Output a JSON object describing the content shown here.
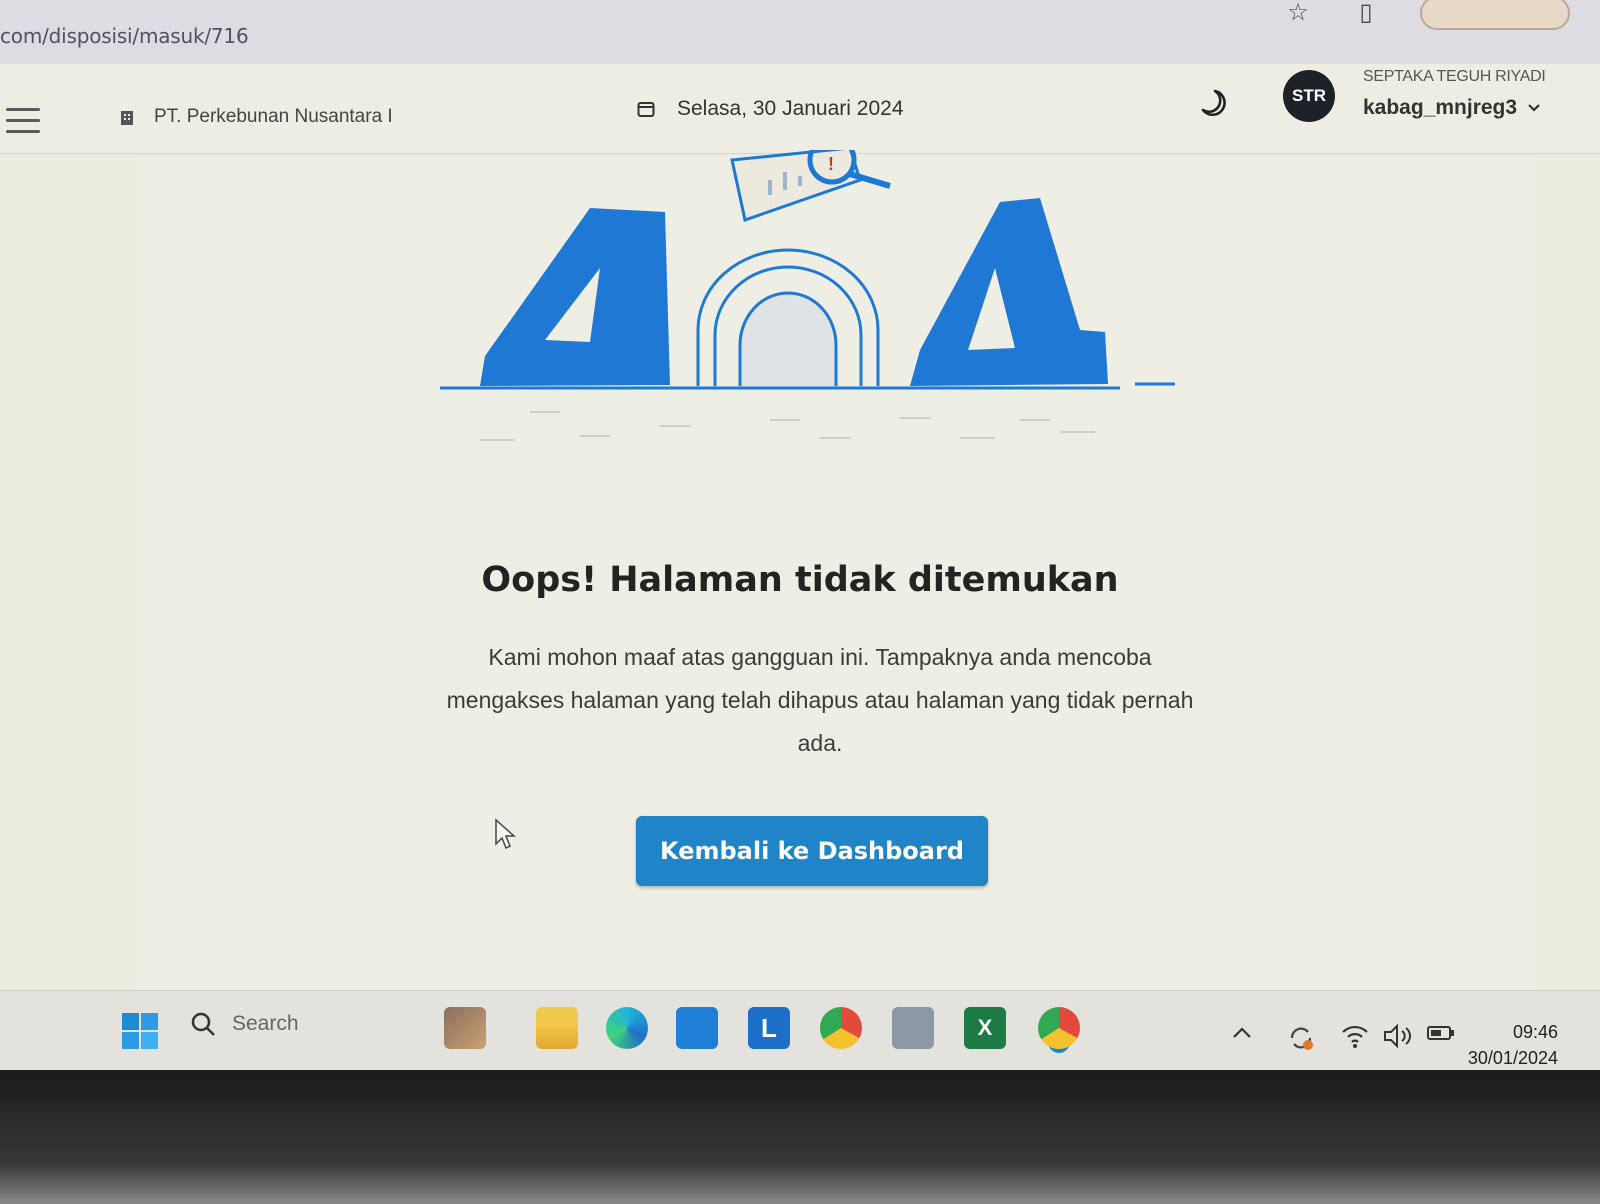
{
  "browser": {
    "url": "com/disposisi/masuk/716"
  },
  "header": {
    "company": "PT. Perkebunan Nusantara I",
    "date": "Selasa, 30 Januari 2024",
    "avatar_initials": "STR",
    "user_name": "SEPTAKA TEGUH RIYADI",
    "user_role": "kabag_mnjreg3"
  },
  "error": {
    "title": "Oops! Halaman tidak ditemukan",
    "message": "Kami mohon maaf atas gangguan ini. Tampaknya anda mencoba mengakses halaman yang telah dihapus atau halaman yang tidak pernah ada.",
    "button_label": "Kembali ke Dashboard"
  },
  "taskbar": {
    "search_placeholder": "Search",
    "time": "09:46",
    "date": "30/01/2024",
    "apps": [
      "widgets-icon",
      "file-explorer-icon",
      "edge-icon",
      "store-icon",
      "l-app-icon",
      "chrome-icon",
      "camera-icon",
      "excel-icon",
      "chrome-profile-icon"
    ]
  },
  "colors": {
    "accent": "#1f84c8",
    "illustration_blue": "#1e78d4",
    "page_bg": "#ecebe0"
  }
}
